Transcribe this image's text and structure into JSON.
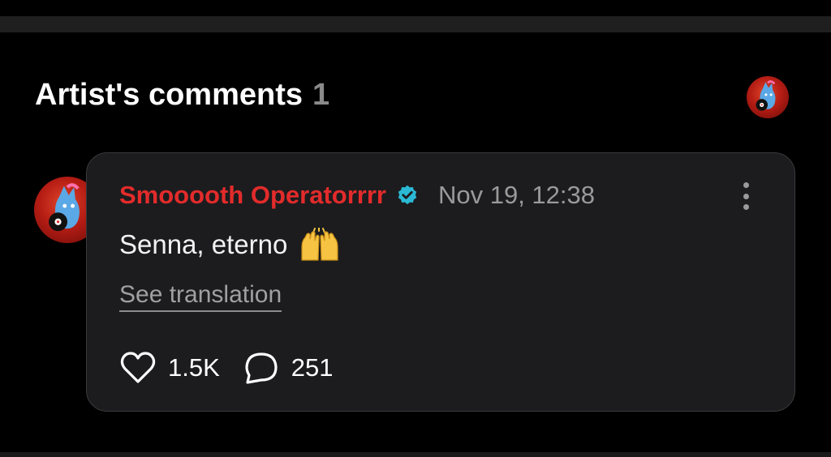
{
  "section": {
    "title": "Artist's comments",
    "count": "1"
  },
  "comment": {
    "author": "Smooooth Operatorrrr",
    "verified": true,
    "timestamp": "Nov 19, 12:38",
    "text": "Senna, eterno",
    "emoji": "raising-hands",
    "translation_link": "See translation",
    "likes": "1.5K",
    "replies": "251"
  },
  "colors": {
    "background": "#000000",
    "card": "#1c1c1e",
    "author": "#e32b2b",
    "verified_badge": "#2bb8d4",
    "muted": "#9a9a9a"
  },
  "icons": {
    "more": "kebab-menu-icon",
    "like": "heart-icon",
    "reply": "speech-bubble-icon",
    "verified": "verified-badge-icon"
  }
}
